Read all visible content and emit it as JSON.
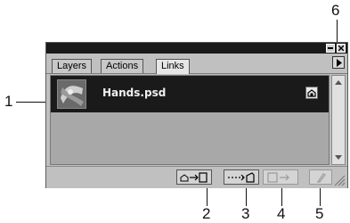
{
  "callouts": [
    "1",
    "2",
    "3",
    "4",
    "5",
    "6"
  ],
  "panel": {
    "tabs": [
      {
        "label": "Layers",
        "active": false
      },
      {
        "label": "Actions",
        "active": false
      },
      {
        "label": "Links",
        "active": true
      }
    ],
    "links": [
      {
        "filename": "Hands.psd",
        "selected": true
      }
    ],
    "footer_buttons": [
      {
        "name": "go-to-link",
        "icon": "go-to-link-icon",
        "enabled": true
      },
      {
        "name": "edit-original",
        "icon": "edit-original-icon",
        "enabled": true
      },
      {
        "name": "update-link",
        "icon": "update-link-icon",
        "enabled": false
      },
      {
        "name": "relink",
        "icon": "relink-icon",
        "enabled": false
      }
    ]
  }
}
